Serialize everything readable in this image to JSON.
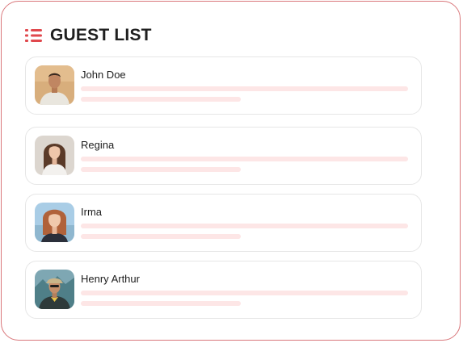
{
  "header": {
    "title": "GUEST LIST",
    "icon": "list-icon",
    "accent_color": "#e0484d"
  },
  "guests": [
    {
      "name": "John Doe",
      "avatar": "person-photo-avatar"
    },
    {
      "name": "Regina",
      "avatar": "person-photo-avatar"
    },
    {
      "name": "Irma",
      "avatar": "person-photo-avatar"
    },
    {
      "name": "Henry Arthur",
      "avatar": "person-photo-avatar"
    }
  ],
  "colors": {
    "panel_border": "#d9767a",
    "card_border": "#e6e6e6",
    "placeholder_bar": "#fde6e6"
  }
}
